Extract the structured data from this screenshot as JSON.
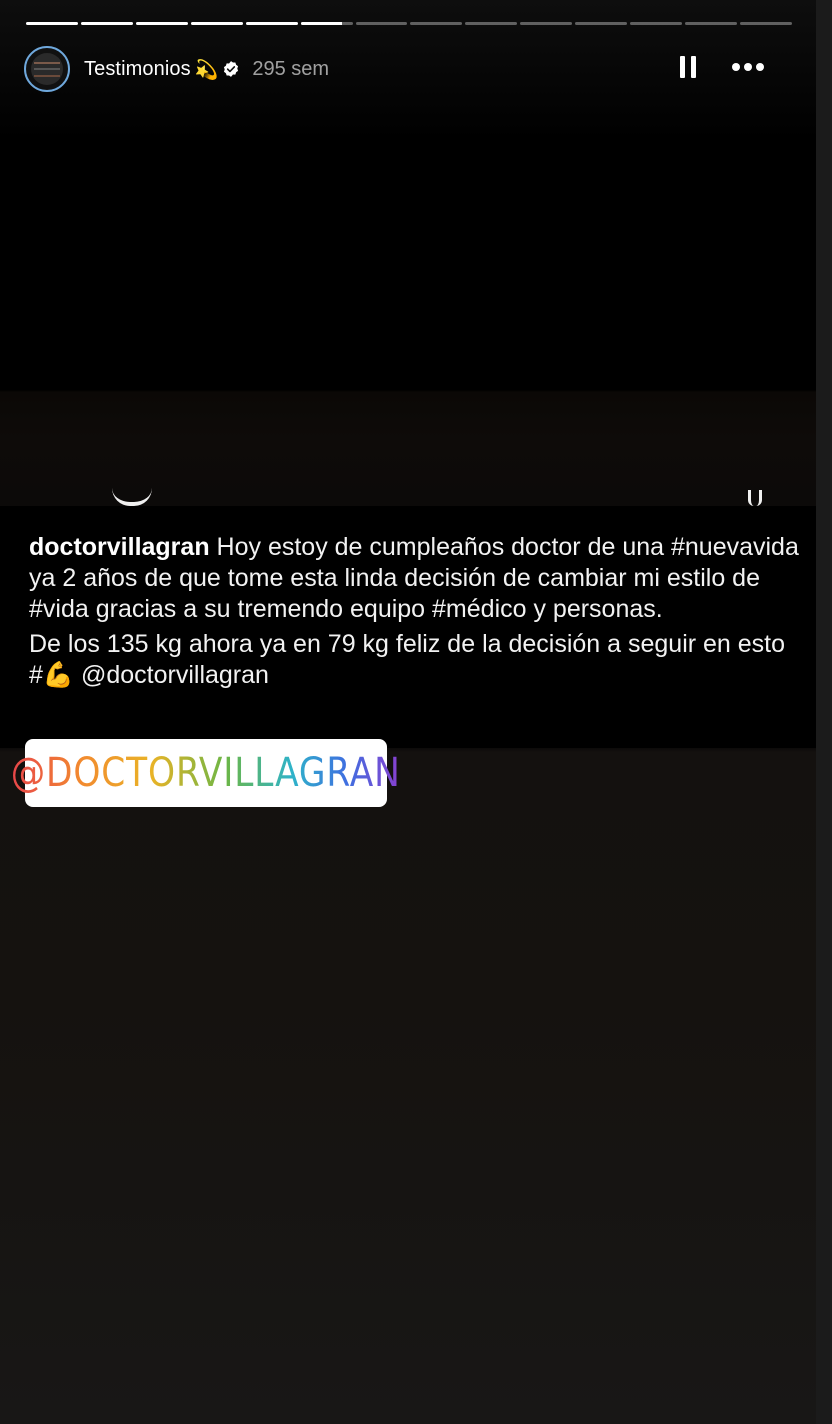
{
  "story": {
    "account_name": "Testimonios",
    "account_emoji": "💫",
    "verified": true,
    "posted_ago": "295 sem",
    "progress": {
      "segments_total": 14,
      "segments_completed": 5,
      "current_segment_progress": 0.8
    }
  },
  "icons": {
    "pause": "pause-icon",
    "more": "more-options-icon",
    "verified": "verified-badge-icon"
  },
  "caption": {
    "username": "doctorvillagran",
    "line1_text": " Hoy estoy de cumpleaños doctor de una #nuevavida ya 2 años de que tome esta linda decisión de cambiar mi estilo de #vida gracias a su tremendo equipo #médico y personas.",
    "line2_text": "De los 135 kg ahora ya en 79 kg feliz de la decisión a seguir en esto #💪 @doctorvillagran"
  },
  "sticker": {
    "mention_label": "@DOCTORVILLAGRAN"
  },
  "colors": {
    "avatar_ring": "#6fa8dc",
    "background": "#000000",
    "sticker_background": "#ffffff"
  }
}
